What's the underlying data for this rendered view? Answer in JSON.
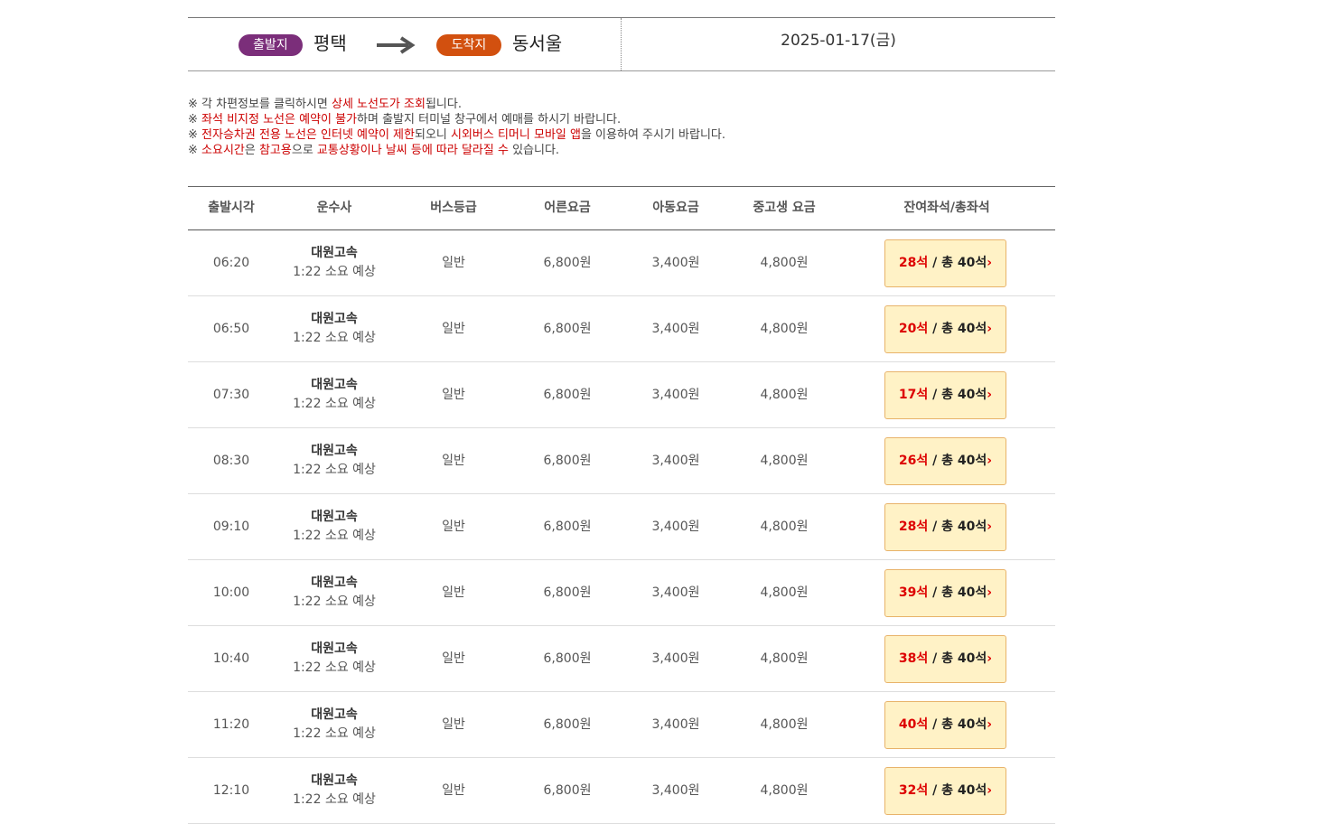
{
  "route": {
    "departure_badge": "출발지",
    "departure": "평택",
    "arrival_badge": "도착지",
    "arrival": "동서울",
    "date": "2025-01-17(금)"
  },
  "colors": {
    "departure_badge": "#7b2e7a",
    "arrival_badge": "#d2500f",
    "highlight": "#cc0000",
    "seat_button_bg": "#fff2c6",
    "seat_button_border": "#e8b36a"
  },
  "notices": [
    [
      {
        "t": "※ 각 차편정보를 클릭하시면 ",
        "h": false
      },
      {
        "t": "상세 노선도가 조회",
        "h": true
      },
      {
        "t": "됩니다.",
        "h": false
      }
    ],
    [
      {
        "t": "※ ",
        "h": false
      },
      {
        "t": "좌석 비지정 노선은 예약이 불가",
        "h": true
      },
      {
        "t": "하며 출발지 터미널 창구에서 예매를 하시기 바랍니다.",
        "h": false
      }
    ],
    [
      {
        "t": "※ ",
        "h": false
      },
      {
        "t": "전자승차권 전용 노선은 인터넷 예약이 제한",
        "h": true
      },
      {
        "t": "되오니 ",
        "h": false
      },
      {
        "t": "시외버스 티머니 모바일 앱",
        "h": true
      },
      {
        "t": "을 이용하여 주시기 바랍니다.",
        "h": false
      }
    ],
    [
      {
        "t": "※ ",
        "h": false
      },
      {
        "t": "소요시간",
        "h": true
      },
      {
        "t": "은 ",
        "h": false
      },
      {
        "t": "참고용",
        "h": true
      },
      {
        "t": "으로 ",
        "h": false
      },
      {
        "t": "교통상황이나 날씨 등에 따라 달라질 수",
        "h": true
      },
      {
        "t": " 있습니다.",
        "h": false
      }
    ]
  ],
  "table": {
    "headers": {
      "time": "출발시각",
      "company": "운수사",
      "grade": "버스등급",
      "adult": "어른요금",
      "child": "아동요금",
      "student": "중고생 요금",
      "seats": "잔여좌석/총좌석"
    },
    "rows": [
      {
        "time": "06:20",
        "company": "대원고속",
        "duration": "1:22 소요 예상",
        "grade": "일반",
        "adult": "6,800원",
        "child": "3,400원",
        "student": "4,800원",
        "remain": "28석",
        "total": "/ 총 40석"
      },
      {
        "time": "06:50",
        "company": "대원고속",
        "duration": "1:22 소요 예상",
        "grade": "일반",
        "adult": "6,800원",
        "child": "3,400원",
        "student": "4,800원",
        "remain": "20석",
        "total": "/ 총 40석"
      },
      {
        "time": "07:30",
        "company": "대원고속",
        "duration": "1:22 소요 예상",
        "grade": "일반",
        "adult": "6,800원",
        "child": "3,400원",
        "student": "4,800원",
        "remain": "17석",
        "total": "/ 총 40석"
      },
      {
        "time": "08:30",
        "company": "대원고속",
        "duration": "1:22 소요 예상",
        "grade": "일반",
        "adult": "6,800원",
        "child": "3,400원",
        "student": "4,800원",
        "remain": "26석",
        "total": "/ 총 40석"
      },
      {
        "time": "09:10",
        "company": "대원고속",
        "duration": "1:22 소요 예상",
        "grade": "일반",
        "adult": "6,800원",
        "child": "3,400원",
        "student": "4,800원",
        "remain": "28석",
        "total": "/ 총 40석"
      },
      {
        "time": "10:00",
        "company": "대원고속",
        "duration": "1:22 소요 예상",
        "grade": "일반",
        "adult": "6,800원",
        "child": "3,400원",
        "student": "4,800원",
        "remain": "39석",
        "total": "/ 총 40석"
      },
      {
        "time": "10:40",
        "company": "대원고속",
        "duration": "1:22 소요 예상",
        "grade": "일반",
        "adult": "6,800원",
        "child": "3,400원",
        "student": "4,800원",
        "remain": "38석",
        "total": "/ 총 40석"
      },
      {
        "time": "11:20",
        "company": "대원고속",
        "duration": "1:22 소요 예상",
        "grade": "일반",
        "adult": "6,800원",
        "child": "3,400원",
        "student": "4,800원",
        "remain": "40석",
        "total": "/ 총 40석"
      },
      {
        "time": "12:10",
        "company": "대원고속",
        "duration": "1:22 소요 예상",
        "grade": "일반",
        "adult": "6,800원",
        "child": "3,400원",
        "student": "4,800원",
        "remain": "32석",
        "total": "/ 총 40석"
      }
    ]
  }
}
